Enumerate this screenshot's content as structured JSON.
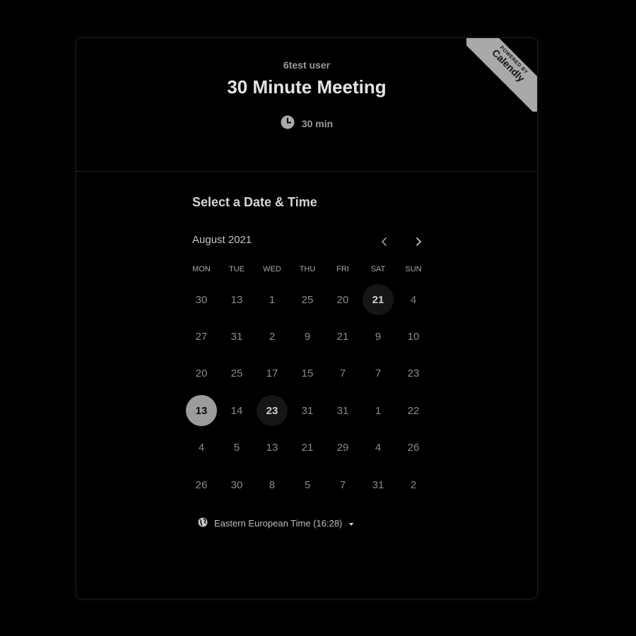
{
  "header": {
    "host_name": "6test user",
    "event_title": "30 Minute Meeting",
    "duration": "30 min",
    "ribbon_small": "POWERED BY",
    "ribbon_brand": "Calendly"
  },
  "scheduler": {
    "title": "Select a Date & Time",
    "month_label": "August 2021",
    "icons": {
      "prev": "chevron-left-icon",
      "next": "chevron-right-icon",
      "duration": "clock-icon",
      "timezone": "globe-icon",
      "dropdown": "caret-down-icon"
    },
    "weekdays": [
      "MON",
      "TUE",
      "WED",
      "THU",
      "FRI",
      "SAT",
      "SUN"
    ],
    "weeks": [
      [
        "30",
        "13",
        "1",
        "25",
        "20",
        "21",
        "4"
      ],
      [
        "27",
        "31",
        "2",
        "9",
        "21",
        "9",
        "10"
      ],
      [
        "20",
        "25",
        "17",
        "15",
        "7",
        "7",
        "23"
      ],
      [
        "13",
        "14",
        "23",
        "31",
        "31",
        "1",
        "22"
      ],
      [
        "4",
        "5",
        "13",
        "21",
        "29",
        "4",
        "26"
      ],
      [
        "26",
        "30",
        "8",
        "5",
        "7",
        "31",
        "2"
      ]
    ],
    "timezone_label": "Eastern European Time (16:28)"
  }
}
